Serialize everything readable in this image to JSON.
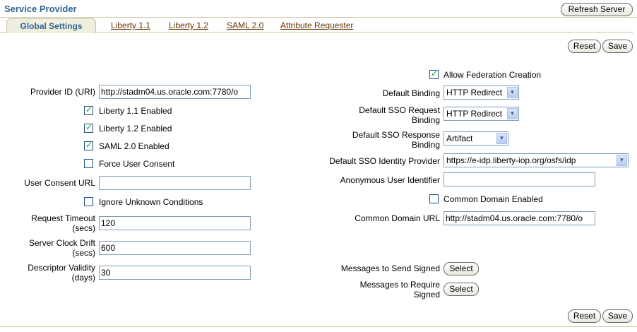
{
  "header": {
    "title": "Service Provider",
    "refresh_label": "Refresh Server"
  },
  "tabs": [
    {
      "label": "Global Settings",
      "active": true
    },
    {
      "label": "Liberty 1.1"
    },
    {
      "label": "Liberty 1.2"
    },
    {
      "label": "SAML 2.0"
    },
    {
      "label": "Attribute Requester"
    }
  ],
  "actions": {
    "reset_label": "Reset",
    "save_label": "Save"
  },
  "left": {
    "provider_id_label": "Provider ID (URI)",
    "provider_id_value": "http://stadm04.us.oracle.com:7780/o",
    "liberty11_label": "Liberty 1.1 Enabled",
    "liberty11_checked": true,
    "liberty12_label": "Liberty 1.2 Enabled",
    "liberty12_checked": true,
    "saml20_label": "SAML 2.0 Enabled",
    "saml20_checked": true,
    "force_consent_label": "Force User Consent",
    "force_consent_checked": false,
    "consent_url_label": "User Consent URL",
    "consent_url_value": "",
    "ignore_unknown_label": "Ignore Unknown Conditions",
    "ignore_unknown_checked": false,
    "request_timeout_label_1": "Request Timeout",
    "request_timeout_label_2": "(secs)",
    "request_timeout_value": "120",
    "clock_drift_label_1": "Server Clock Drift",
    "clock_drift_label_2": "(secs)",
    "clock_drift_value": "600",
    "descriptor_validity_label_1": "Descriptor Validity",
    "descriptor_validity_label_2": "(days)",
    "descriptor_validity_value": "30"
  },
  "right": {
    "allow_federation_label": "Allow Federation Creation",
    "allow_federation_checked": true,
    "default_binding_label": "Default Binding",
    "default_binding_value": "HTTP Redirect",
    "sso_request_binding_label_1": "Default SSO Request",
    "sso_request_binding_label_2": "Binding",
    "sso_request_binding_value": "HTTP Redirect",
    "sso_response_binding_label_1": "Default SSO Response",
    "sso_response_binding_label_2": "Binding",
    "sso_response_binding_value": "Artifact",
    "sso_idp_label": "Default SSO Identity Provider",
    "sso_idp_value": "https://e-idp.liberty-iop.org/osfs/idp",
    "anon_user_label": "Anonymous User Identifier",
    "anon_user_value": "",
    "common_domain_enabled_label": "Common Domain Enabled",
    "common_domain_enabled_checked": false,
    "common_domain_url_label": "Common Domain URL",
    "common_domain_url_value": "http://stadm04.us.oracle.com:7780/o",
    "messages_send_signed_label": "Messages to Send Signed",
    "select_label": "Select",
    "messages_require_signed_label_1": "Messages to Require",
    "messages_require_signed_label_2": "Signed"
  },
  "colors": {
    "title": "#336699",
    "tab_link": "#663300",
    "checkmark": "#21a121",
    "rule": "#c9c5a4"
  },
  "icons": {
    "checkbox_checked": "checkmark-icon",
    "dropdown": "chevron-down-icon"
  }
}
